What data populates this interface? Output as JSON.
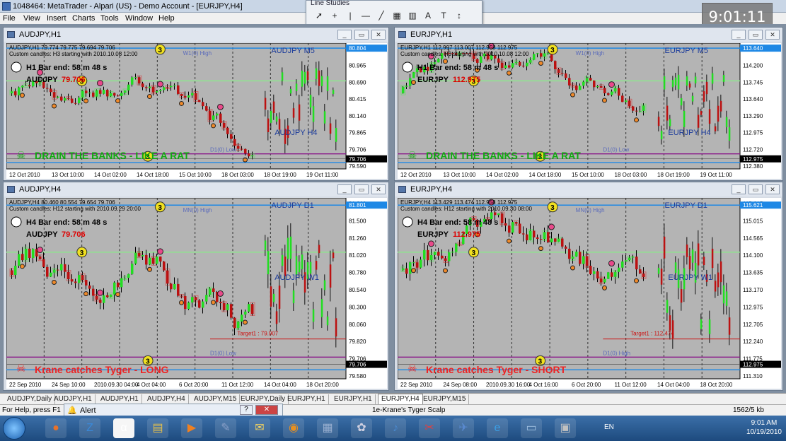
{
  "window": {
    "title": "1048464: MetaTrader - Alpari (US) - Demo Account - [EURJPY,H4]"
  },
  "menu": [
    "File",
    "View",
    "Insert",
    "Charts",
    "Tools",
    "Window",
    "Help"
  ],
  "line_studies": {
    "title": "Line Studies",
    "tools": [
      "cursor-icon",
      "crosshair-icon",
      "vertical-line-icon",
      "horizontal-line-icon",
      "trendline-icon",
      "fibo-icon",
      "grid-icon",
      "text-icon",
      "label-icon",
      "arrows-icon"
    ],
    "glyphs": [
      "➚",
      "+",
      "|",
      "—",
      "╱",
      "▦",
      "▥",
      "A",
      "T",
      "↕"
    ]
  },
  "clock_widget": "9:01:11",
  "colors": {
    "chart_bg": "#b4b4b4",
    "bull": "#22dd22",
    "bear": "#bb1111",
    "accent_blue": "#1a3a9a"
  },
  "charts": [
    {
      "title": "AUDJPY,H1",
      "info": "AUDJPY,H1  79.774 79.775 79.694 79.706",
      "custom": "Custom candles: H3 starting with 2010.10.08 12:00",
      "bar_end": "H1 Bar end: 58 m 48 s",
      "symbol": "AUDJPY",
      "price": "79.706",
      "tf1": "AUDJPY M5",
      "tf2": "AUDJPY H4",
      "banner": "DRAIN THE BANKS - LIKE A RAT",
      "banner_color": "#11aa11",
      "pivot_label": "W1(0) High",
      "pivot_label2": "D1(0) Low",
      "ticks": [
        "81.240",
        "80.965",
        "80.690",
        "80.415",
        "80.140",
        "79.865",
        "79.706",
        "79.590"
      ],
      "dates": [
        "12 Oct 2010",
        "13 Oct 10:00",
        "14 Oct 02:00",
        "14 Oct 18:00",
        "15 Oct 10:00",
        "18 Oct 03:00",
        "18 Oct 19:00",
        "19 Oct 11:00"
      ],
      "price_tag": "79.706",
      "level_tag": "80.804"
    },
    {
      "title": "EURJPY,H1",
      "info": "EURJPY,H1  112.997 113.007 112.958 112.975",
      "custom": "Custom candles: H3 starting with 2010.10.08 12:00",
      "bar_end": "H1 Bar end: 58 m 48 s",
      "symbol": "EURJPY",
      "price": "112.975",
      "tf1": "EURJPY M5",
      "tf2": "EURJPY H4",
      "banner": "DRAIN THE BANKS - LIKE A RAT",
      "banner_color": "#11aa11",
      "pivot_label": "W1(0) High",
      "pivot_label2": "D1(0) Low",
      "ticks": [
        "114.655",
        "114.200",
        "113.745",
        "113.640",
        "113.290",
        "112.975",
        "112.720",
        "112.380"
      ],
      "dates": [
        "12 Oct 2010",
        "13 Oct 10:00",
        "14 Oct 02:00",
        "14 Oct 18:00",
        "15 Oct 10:00",
        "18 Oct 03:00",
        "18 Oct 19:00",
        "19 Oct 11:00"
      ],
      "price_tag": "112.975",
      "level_tag": "113.640"
    },
    {
      "title": "AUDJPY,H4",
      "info": "AUDJPY,H4  80.460 80.554 79.654 79.706",
      "custom": "Custom candles: H12 starting with 2010.09.29 20:00",
      "bar_end": "H4 Bar end: 58 m 48 s",
      "symbol": "AUDJPY",
      "price": "79.706",
      "tf1": "AUDJPY D1",
      "tf2": "AUDJPY W1",
      "banner": "Krane catches Tyger - LONG",
      "banner_color": "#ee2222",
      "pivot_label": "MN(0) High",
      "pivot_label2": "D1(0) Low",
      "ticks": [
        "81.800",
        "81.500",
        "81.260",
        "81.020",
        "80.780",
        "80.540",
        "80.300",
        "80.060",
        "79.820",
        "79.706",
        "79.580"
      ],
      "dates": [
        "22 Sep 2010",
        "24 Sep 10:00",
        "2010.09.30 04:00",
        "4 Oct 04:00",
        "6 Oct 20:00",
        "11 Oct 12:00",
        "14 Oct 04:00",
        "18 Oct 20:00"
      ],
      "price_tag": "79.706",
      "level_tag": "81.801",
      "target": "Target1 : 79.907"
    },
    {
      "title": "EURJPY,H4",
      "info": "EURJPY,H4  113.429 113.474 112.958 112.975",
      "custom": "Custom candles: H12 starting with 2010.09.30 08:00",
      "bar_end": "H4 Bar end: 58 m 48 s",
      "symbol": "EURJPY",
      "price": "112.975",
      "tf1": "EURJPY D1",
      "tf2": "EURJPY W1",
      "banner": "Krane catches Tyger - SHORT",
      "banner_color": "#ee2222",
      "pivot_label": "MN(0) High",
      "pivot_label2": "D1(0) High",
      "ticks": [
        "115.615",
        "115.015",
        "114.565",
        "114.100",
        "113.635",
        "113.170",
        "112.975",
        "112.705",
        "112.240",
        "111.775",
        "111.310"
      ],
      "dates": [
        "22 Sep 2010",
        "24 Sep 08:00",
        "2010.09.30 16:00",
        "4 Oct 16:00",
        "6 Oct 20:00",
        "11 Oct 12:00",
        "14 Oct 04:00",
        "18 Oct 20:00"
      ],
      "price_tag": "112.975",
      "level_tag": "115.621",
      "target": "Target1 : 112.474"
    }
  ],
  "tabs": [
    "AUDJPY,Daily",
    "AUDJPY,H1",
    "AUDJPY,H1",
    "AUDJPY,H4",
    "AUDJPY,M15",
    "EURJPY,Daily",
    "EURJPY,H1",
    "EURJPY,H1",
    "EURJPY,H4",
    "EURJPY,M15"
  ],
  "active_tab": 8,
  "status": {
    "help": "For Help, press F1",
    "alert": "Alert",
    "profile": "1e-Krane's Tyger Scalp",
    "traffic": "1562/5 kb"
  },
  "taskbar": {
    "lang": "EN",
    "time": "9:01 AM",
    "date": "10/19/2010"
  }
}
